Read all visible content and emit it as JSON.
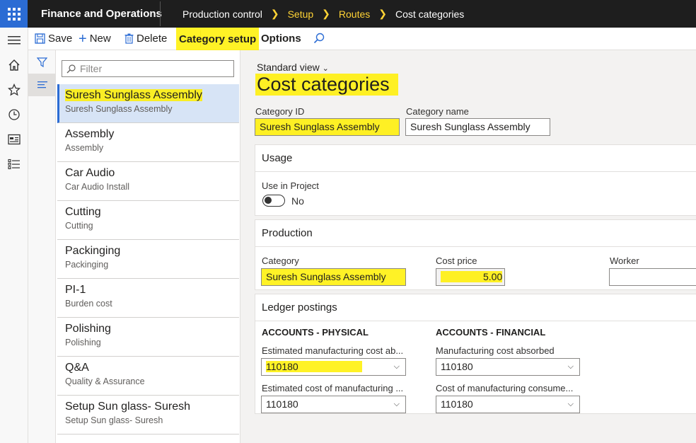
{
  "app": {
    "title": "Finance and Operations",
    "breadcrumbs": [
      "Production control",
      "Setup",
      "Routes",
      "Cost categories"
    ]
  },
  "actions": {
    "save": "Save",
    "new": "New",
    "delete": "Delete",
    "category_setup": "Category setup",
    "options": "Options"
  },
  "list": {
    "filter_placeholder": "Filter",
    "items": [
      {
        "title": "Suresh Sunglass Assembly",
        "subtitle": "Suresh Sunglass Assembly"
      },
      {
        "title": "Assembly",
        "subtitle": "Assembly"
      },
      {
        "title": "Car Audio",
        "subtitle": "Car Audio Install"
      },
      {
        "title": "Cutting",
        "subtitle": "Cutting"
      },
      {
        "title": "Packinging",
        "subtitle": "Packinging"
      },
      {
        "title": "PI-1",
        "subtitle": "Burden cost"
      },
      {
        "title": "Polishing",
        "subtitle": "Polishing"
      },
      {
        "title": "Q&A",
        "subtitle": "Quality & Assurance"
      },
      {
        "title": "Setup Sun glass- Suresh",
        "subtitle": "Setup Sun glass- Suresh"
      }
    ]
  },
  "page": {
    "view": "Standard view",
    "title": "Cost categories",
    "category_id_label": "Category ID",
    "category_id": "Suresh Sunglass Assembly",
    "category_name_label": "Category name",
    "category_name": "Suresh Sunglass Assembly"
  },
  "usage": {
    "header": "Usage",
    "use_in_project_label": "Use in Project",
    "use_in_project_value": "No"
  },
  "production": {
    "header": "Production",
    "category_label": "Category",
    "category": "Suresh Sunglass Assembly",
    "cost_price_label": "Cost price",
    "cost_price": "5.00",
    "worker_label": "Worker",
    "worker": ""
  },
  "ledger": {
    "header": "Ledger postings",
    "physical_header": "ACCOUNTS - PHYSICAL",
    "financial_header": "ACCOUNTS - FINANCIAL",
    "est_absorbed_label": "Estimated manufacturing cost ab...",
    "est_absorbed": "110180",
    "est_consumed_label": "Estimated cost of manufacturing ...",
    "est_consumed": "110180",
    "mfg_absorbed_label": "Manufacturing cost absorbed",
    "mfg_absorbed": "110180",
    "mfg_consumed_label": "Cost of manufacturing consume...",
    "mfg_consumed": "110180"
  },
  "colors": {
    "accent": "#2b6cd4",
    "topbar": "#1e1e1e",
    "breadcrumb_link": "#ffd335",
    "highlight": "#fff000"
  }
}
